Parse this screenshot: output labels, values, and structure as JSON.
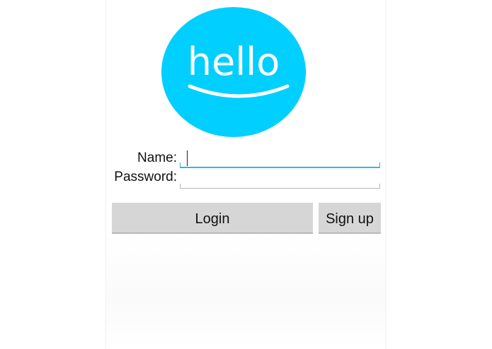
{
  "logo": {
    "text": "hello",
    "circle_color": "#00cfff",
    "text_color": "#ffffff",
    "icon": "hello-smile-logo"
  },
  "form": {
    "name_label": "Name:",
    "name_value": "",
    "password_label": "Password:",
    "password_value": "",
    "accent_color": "#33b5e5"
  },
  "buttons": {
    "login_label": "Login",
    "signup_label": "Sign up"
  }
}
